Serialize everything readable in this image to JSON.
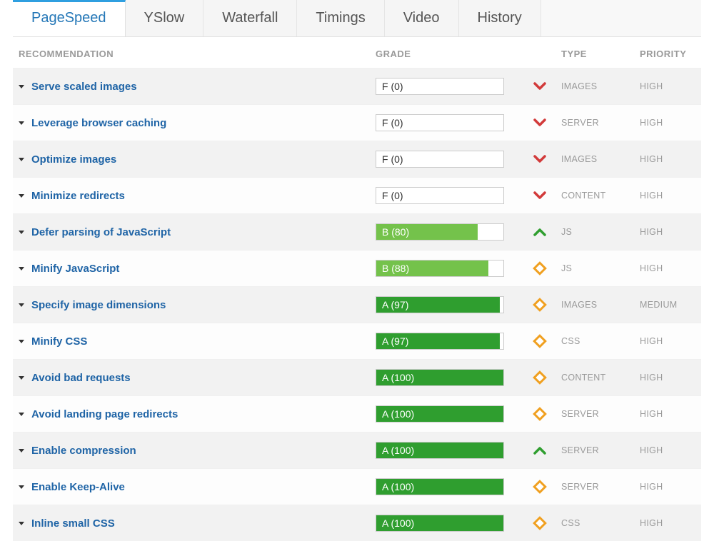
{
  "tabs": [
    {
      "label": "PageSpeed",
      "active": true
    },
    {
      "label": "YSlow",
      "active": false
    },
    {
      "label": "Waterfall",
      "active": false
    },
    {
      "label": "Timings",
      "active": false
    },
    {
      "label": "Video",
      "active": false
    },
    {
      "label": "History",
      "active": false
    }
  ],
  "headers": {
    "recommendation": "RECOMMENDATION",
    "grade": "GRADE",
    "type": "TYPE",
    "priority": "PRIORITY"
  },
  "rows": [
    {
      "rec": "Serve scaled images",
      "grade_label": "F (0)",
      "score": 0,
      "bar": "none",
      "icon": "down-red",
      "type": "IMAGES",
      "priority": "HIGH"
    },
    {
      "rec": "Leverage browser caching",
      "grade_label": "F (0)",
      "score": 0,
      "bar": "none",
      "icon": "down-red",
      "type": "SERVER",
      "priority": "HIGH"
    },
    {
      "rec": "Optimize images",
      "grade_label": "F (0)",
      "score": 0,
      "bar": "none",
      "icon": "down-red",
      "type": "IMAGES",
      "priority": "HIGH"
    },
    {
      "rec": "Minimize redirects",
      "grade_label": "F (0)",
      "score": 0,
      "bar": "none",
      "icon": "down-red",
      "type": "CONTENT",
      "priority": "HIGH"
    },
    {
      "rec": "Defer parsing of JavaScript",
      "grade_label": "B (80)",
      "score": 80,
      "bar": "lightgreen",
      "icon": "up-green",
      "type": "JS",
      "priority": "HIGH"
    },
    {
      "rec": "Minify JavaScript",
      "grade_label": "B (88)",
      "score": 88,
      "bar": "lightgreen",
      "icon": "diamond",
      "type": "JS",
      "priority": "HIGH"
    },
    {
      "rec": "Specify image dimensions",
      "grade_label": "A (97)",
      "score": 97,
      "bar": "green",
      "icon": "diamond",
      "type": "IMAGES",
      "priority": "MEDIUM"
    },
    {
      "rec": "Minify CSS",
      "grade_label": "A (97)",
      "score": 97,
      "bar": "green",
      "icon": "diamond",
      "type": "CSS",
      "priority": "HIGH"
    },
    {
      "rec": "Avoid bad requests",
      "grade_label": "A (100)",
      "score": 100,
      "bar": "green",
      "icon": "diamond",
      "type": "CONTENT",
      "priority": "HIGH"
    },
    {
      "rec": "Avoid landing page redirects",
      "grade_label": "A (100)",
      "score": 100,
      "bar": "green",
      "icon": "diamond",
      "type": "SERVER",
      "priority": "HIGH"
    },
    {
      "rec": "Enable compression",
      "grade_label": "A (100)",
      "score": 100,
      "bar": "green",
      "icon": "up-green",
      "type": "SERVER",
      "priority": "HIGH"
    },
    {
      "rec": "Enable Keep-Alive",
      "grade_label": "A (100)",
      "score": 100,
      "bar": "green",
      "icon": "diamond",
      "type": "SERVER",
      "priority": "HIGH"
    },
    {
      "rec": "Inline small CSS",
      "grade_label": "A (100)",
      "score": 100,
      "bar": "green",
      "icon": "diamond",
      "type": "CSS",
      "priority": "HIGH"
    }
  ]
}
